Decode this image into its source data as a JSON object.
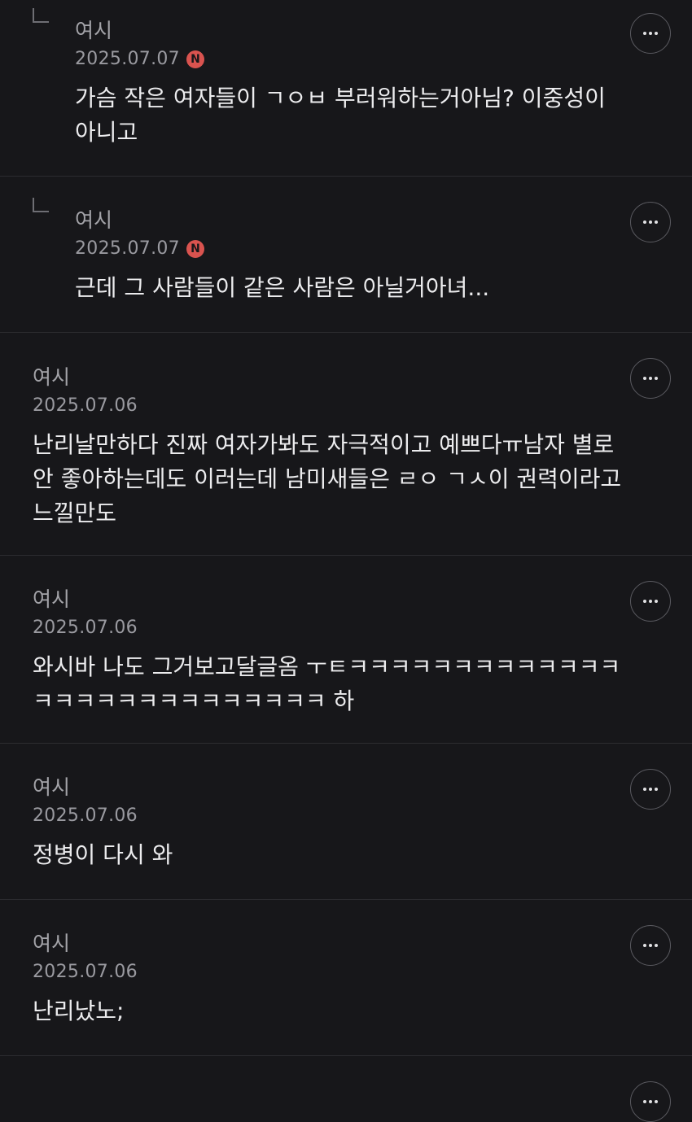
{
  "comments": [
    {
      "author": "여시",
      "date": "2025.07.07",
      "is_reply": true,
      "new_badge": "N",
      "text": "가슴 작은 여자들이 ㄱㅇㅂ 부러워하는거아님? 이중성이 아니고"
    },
    {
      "author": "여시",
      "date": "2025.07.07",
      "is_reply": true,
      "new_badge": "N",
      "text": "근데 그 사람들이 같은 사람은 아닐거아녀..."
    },
    {
      "author": "여시",
      "date": "2025.07.06",
      "is_reply": false,
      "new_badge": "",
      "text": "난리날만하다 진짜 여자가봐도 자극적이고 예쁘다ㅠ남자 별로 안 좋아하는데도 이러는데 남미새들은 ㄹㅇ ㄱㅅ이 권력이라고 느낄만도"
    },
    {
      "author": "여시",
      "date": "2025.07.06",
      "is_reply": false,
      "new_badge": "",
      "text": "와시바 나도 그거보고달글옴 ㅜㅌㅋㅋㅋㅋㅋㅋㅋㅋㅋㅋㅋㅋㅋㅋㅋㅋㅋㅋㅋㅋㅋㅋㅋㅋㅋㅋㅋ 하"
    },
    {
      "author": "여시",
      "date": "2025.07.06",
      "is_reply": false,
      "new_badge": "",
      "text": "정병이 다시 와"
    },
    {
      "author": "여시",
      "date": "2025.07.06",
      "is_reply": false,
      "new_badge": "",
      "text": "난리났노;"
    }
  ]
}
